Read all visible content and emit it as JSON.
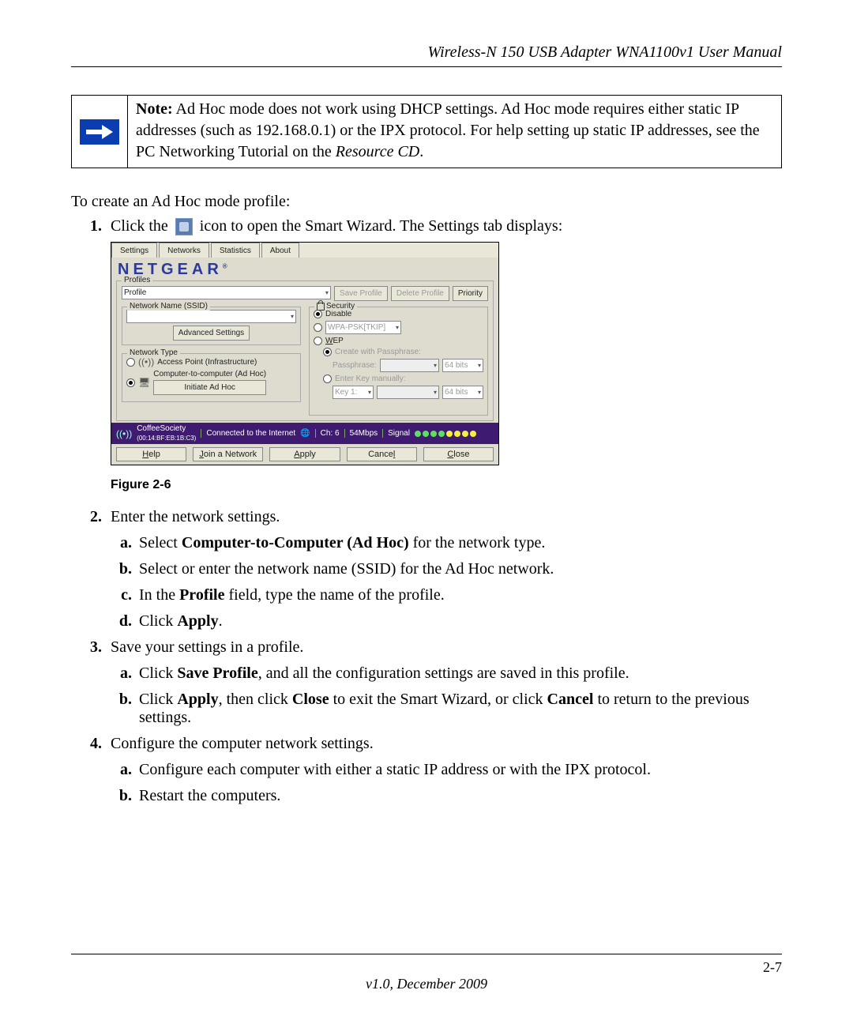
{
  "header": {
    "title": "Wireless-N 150 USB Adapter WNA1100v1 User Manual"
  },
  "note": {
    "label": "Note:",
    "text_prefix": " Ad Hoc mode does not work using DHCP settings. Ad Hoc mode requires either static IP addresses (such as 192.168.0.1) or the IPX protocol. For help setting up static IP addresses, see the PC Networking Tutorial on the ",
    "text_italic": "Resource CD",
    "text_suffix": "."
  },
  "intro": "To create an Ad Hoc mode profile:",
  "step1": {
    "pre": "Click the ",
    "post": " icon to open the Smart Wizard. The Settings tab displays:"
  },
  "figure_caption": "Figure 2-6",
  "screenshot": {
    "tabs": {
      "settings": "Settings",
      "networks": "Networks",
      "statistics": "Statistics",
      "about": "About"
    },
    "logo": "NETGEAR",
    "profiles_legend": "Profiles",
    "profile_value": "Profile",
    "btn_save_profile": "Save Profile",
    "btn_delete_profile": "Delete Profile",
    "btn_priority": "Priority",
    "ssid_legend": "Network Name (SSID)",
    "advanced": "Advanced Settings",
    "network_type_legend": "Network Type",
    "access_point": "Access Point (Infrastructure)",
    "adhoc": "Computer-to-computer (Ad Hoc)",
    "initiate": "Initiate Ad Hoc",
    "security_legend": "Security",
    "disable": "Disable",
    "wpapsk": "WPA-PSK[TKIP]",
    "wep": "WEP",
    "create_pass": "Create with Passphrase:",
    "passphrase": "Passphrase:",
    "bits1": "64 bits",
    "enter_key": "Enter Key manually:",
    "key1": "Key 1:",
    "bits2": "64 bits",
    "status_name": "CoffeeSociety",
    "status_mac": "(00:14:BF:EB:1B:C3)",
    "status_conn": "Connected to the Internet",
    "status_ch_label": "Ch:",
    "status_ch": "6",
    "status_rate": "54Mbps",
    "status_signal": "Signal",
    "btn_help": "Help",
    "btn_join": "Join a Network",
    "btn_apply": "Apply",
    "btn_cancel": "Cancel",
    "btn_close": "Close"
  },
  "step2": {
    "text": "Enter the network settings.",
    "a_pre": "Select ",
    "a_bold": "Computer-to-Computer (Ad Hoc)",
    "a_post": " for the network type.",
    "b": "Select or enter the network name (SSID) for the Ad Hoc network.",
    "c_pre": "In the ",
    "c_bold": "Profile",
    "c_post": " field, type the name of the profile.",
    "d_pre": "Click ",
    "d_bold": "Apply",
    "d_post": "."
  },
  "step3": {
    "text": "Save your settings in a profile.",
    "a_pre": "Click ",
    "a_bold": "Save Profile",
    "a_post": ", and all the configuration settings are saved in this profile.",
    "b_pre": "Click ",
    "b_bold1": "Apply",
    "b_mid1": ", then click ",
    "b_bold2": "Close",
    "b_mid2": " to exit the Smart Wizard, or click ",
    "b_bold3": "Cancel",
    "b_post": " to return to the previous settings."
  },
  "step4": {
    "text": "Configure the computer network settings.",
    "a": "Configure each computer with either a static IP address or with the IPX protocol.",
    "b": "Restart the computers."
  },
  "footer": {
    "page": "2-7",
    "version": "v1.0, December 2009"
  }
}
